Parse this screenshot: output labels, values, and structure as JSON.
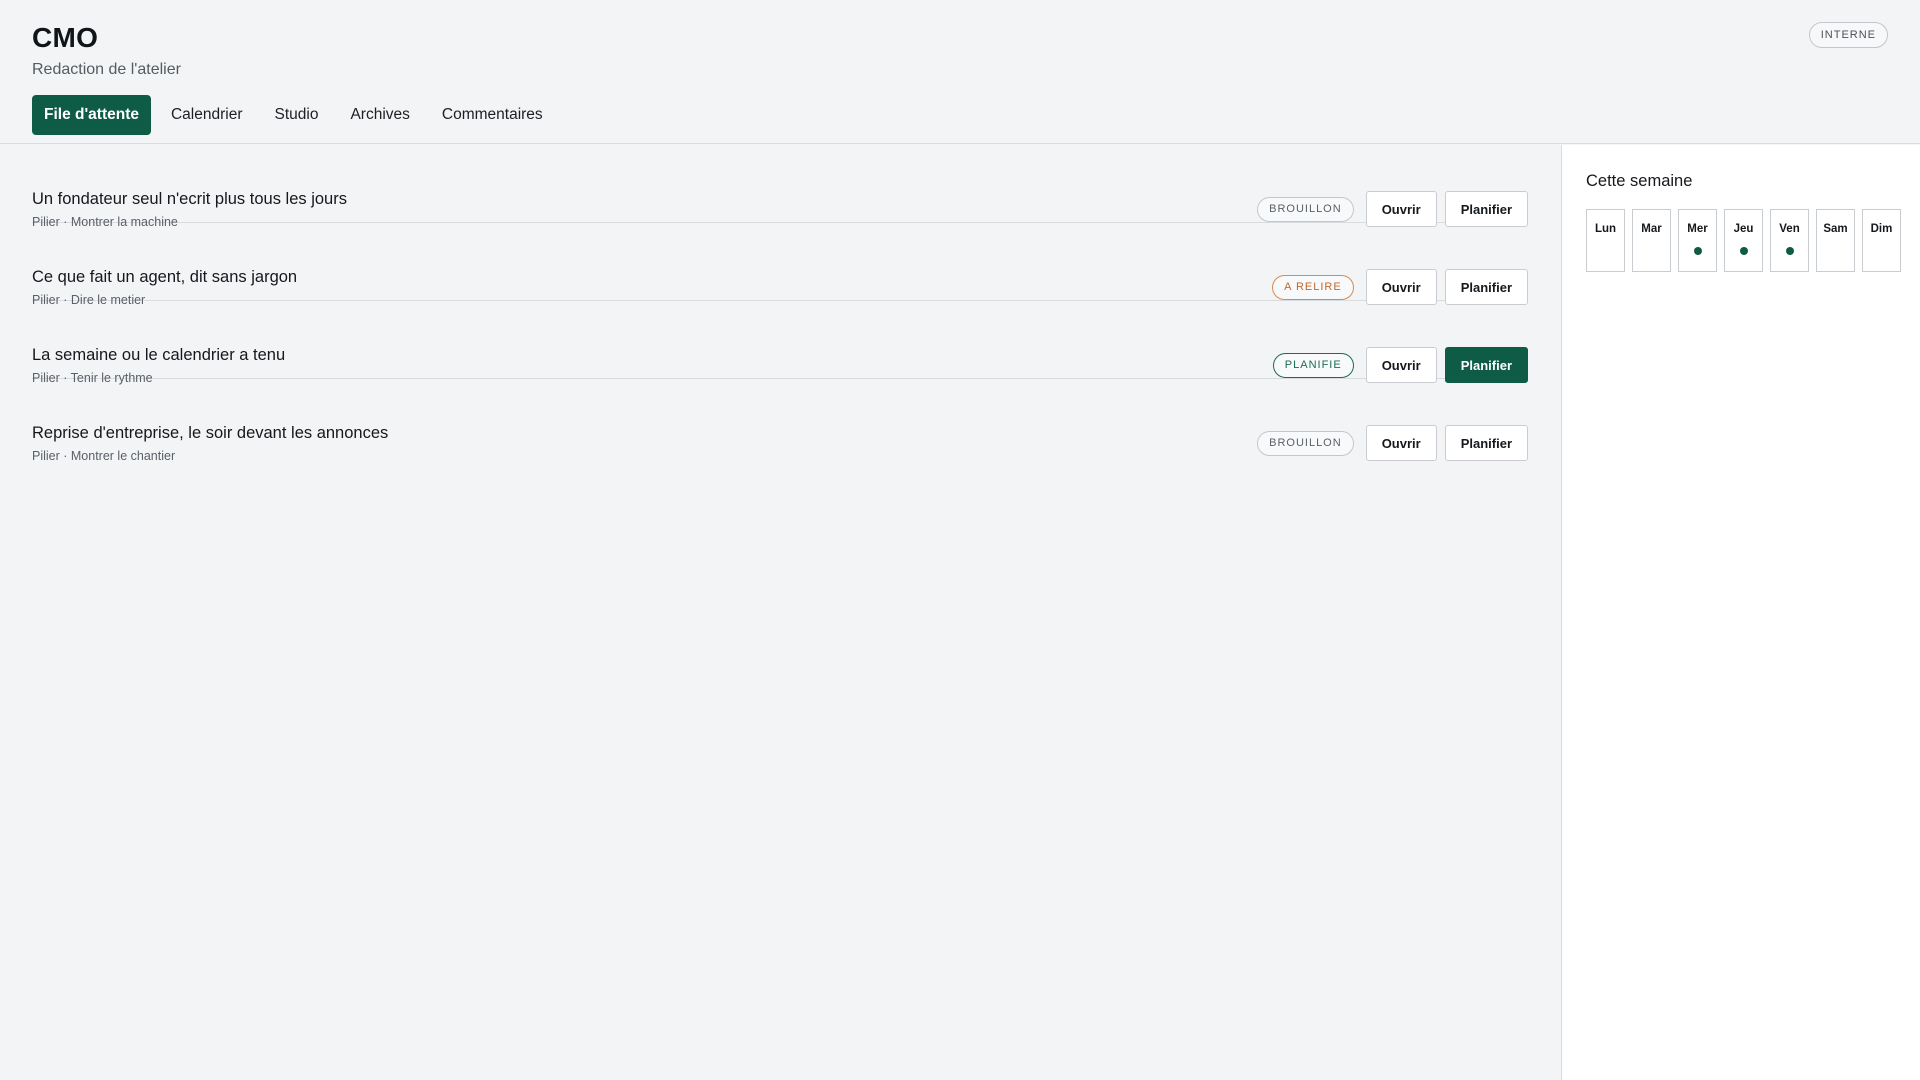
{
  "header": {
    "title": "CMO",
    "subtitle": "Redaction de l'atelier",
    "badge": "INTERNE"
  },
  "tabs": [
    {
      "label": "File d'attente",
      "active": true
    },
    {
      "label": "Calendrier",
      "active": false
    },
    {
      "label": "Studio",
      "active": false
    },
    {
      "label": "Archives",
      "active": false
    },
    {
      "label": "Commentaires",
      "active": false
    }
  ],
  "queue": [
    {
      "title": "Un fondateur seul n'ecrit plus tous les jours",
      "meta": "Pilier · Montrer la machine",
      "status": "BROUILLON",
      "open_label": "Ouvrir",
      "schedule_label": "Planifier"
    },
    {
      "title": "Ce que fait un agent, dit sans jargon",
      "meta": "Pilier · Dire le metier",
      "status": "A RELIRE",
      "open_label": "Ouvrir",
      "schedule_label": "Planifier"
    },
    {
      "title": "La semaine ou le calendrier a tenu",
      "meta": "Pilier · Tenir le rythme",
      "status": "PLANIFIE",
      "open_label": "Ouvrir",
      "schedule_label": "Planifier"
    },
    {
      "title": "Reprise d'entreprise, le soir devant les annonces",
      "meta": "Pilier · Montrer le chantier",
      "status": "BROUILLON",
      "open_label": "Ouvrir",
      "schedule_label": "Planifier"
    }
  ],
  "week": {
    "title": "Cette semaine",
    "days": [
      {
        "label": "Lun",
        "scheduled": false
      },
      {
        "label": "Mar",
        "scheduled": false
      },
      {
        "label": "Mer",
        "scheduled": true
      },
      {
        "label": "Jeu",
        "scheduled": true
      },
      {
        "label": "Ven",
        "scheduled": true
      },
      {
        "label": "Sam",
        "scheduled": false
      },
      {
        "label": "Dim",
        "scheduled": false
      }
    ]
  },
  "colors": {
    "accent": "#0e5c45",
    "review": "#c0692a",
    "background": "#f3f4f6"
  }
}
